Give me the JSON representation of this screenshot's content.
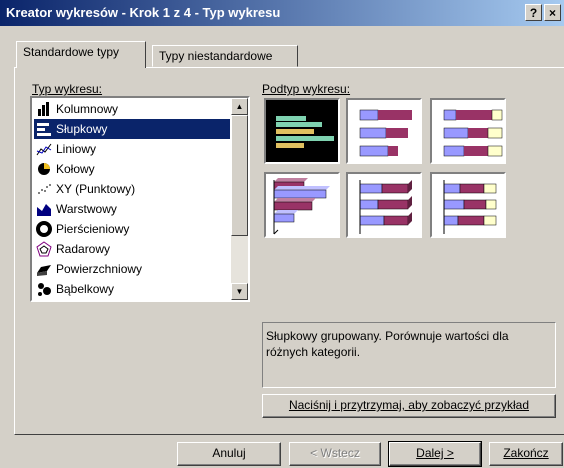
{
  "window": {
    "title": "Kreator wykresów - Krok 1 z 4 - Typ wykresu",
    "help_btn": "?",
    "close_btn": "×"
  },
  "tabs": [
    {
      "label": "Standardowe typy",
      "active": true
    },
    {
      "label": "Typy niestandardowe",
      "active": false
    }
  ],
  "chart_type": {
    "label": "Typ wykresu:",
    "items": [
      {
        "label": "Kolumnowy",
        "icon": "column-chart-icon"
      },
      {
        "label": "Słupkowy",
        "icon": "bar-chart-icon",
        "selected": true
      },
      {
        "label": "Liniowy",
        "icon": "line-chart-icon"
      },
      {
        "label": "Kołowy",
        "icon": "pie-chart-icon"
      },
      {
        "label": "XY (Punktowy)",
        "icon": "scatter-chart-icon"
      },
      {
        "label": "Warstwowy",
        "icon": "area-chart-icon"
      },
      {
        "label": "Pierścieniowy",
        "icon": "doughnut-chart-icon"
      },
      {
        "label": "Radarowy",
        "icon": "radar-chart-icon"
      },
      {
        "label": "Powierzchniowy",
        "icon": "surface-chart-icon"
      },
      {
        "label": "Bąbelkowy",
        "icon": "bubble-chart-icon"
      }
    ]
  },
  "subtype": {
    "label": "Podtyp wykresu:",
    "selected_index": 0,
    "description": "Słupkowy grupowany. Porównuje wartości dla różnych kategorii.",
    "preview_button": "Naciśnij i przytrzymaj, aby zobaczyć przykład"
  },
  "buttons": {
    "cancel": "Anuluj",
    "back": "< Wstecz",
    "next": "Dalej >",
    "finish": "Zakończ"
  },
  "colors": {
    "titlebar_start": "#0a246a",
    "titlebar_end": "#a6caf0",
    "selection": "#0a246a",
    "bar_series_1": "#993366",
    "bar_series_2": "#9999ff",
    "bar_series_3": "#ffffcc"
  }
}
